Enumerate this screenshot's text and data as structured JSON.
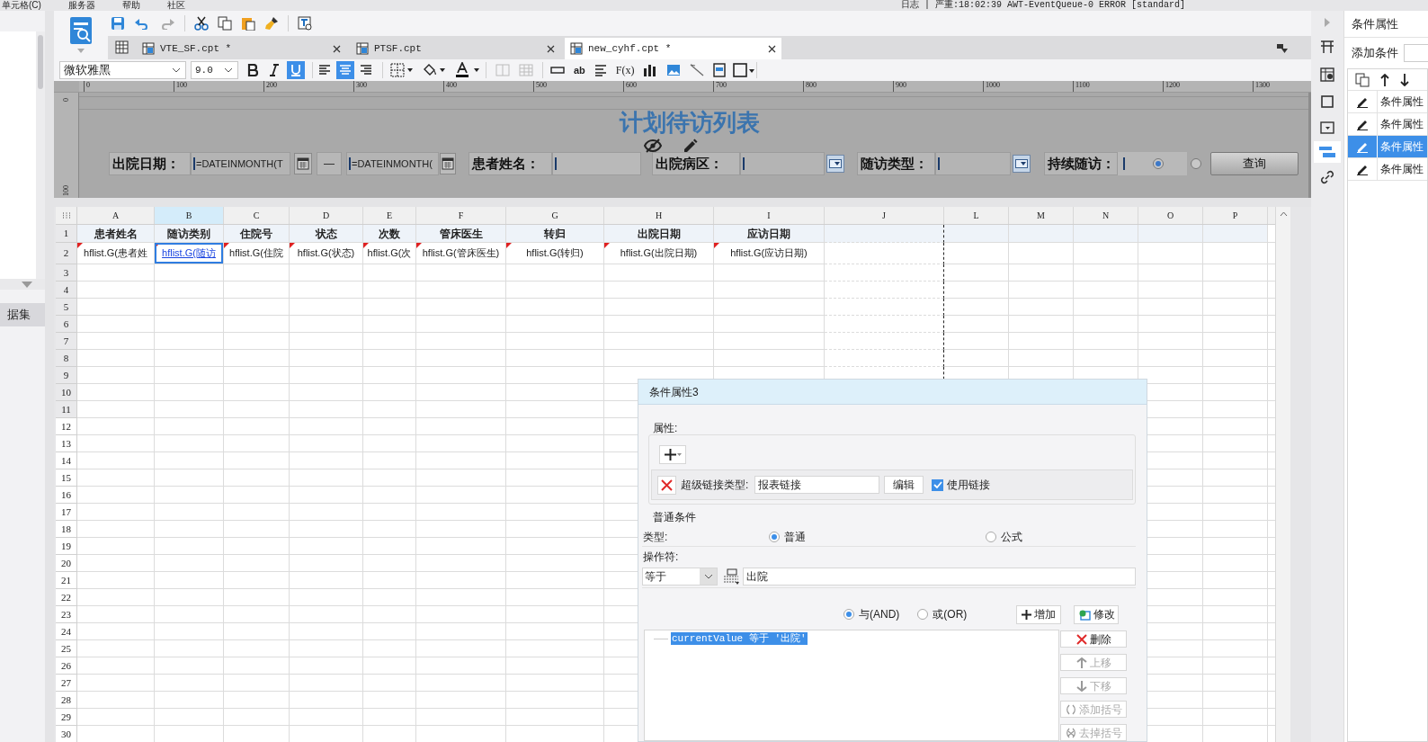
{
  "menu_bar": {
    "items": [
      "单元格(C)",
      "服务器",
      "帮助",
      "社区"
    ],
    "status": "日志 | 严重:18:02:39 AWT-EventQueue-0 ERROR [standard]"
  },
  "file_tabs": [
    {
      "label": "VTE_SF.cpt *",
      "selected": false
    },
    {
      "label": "PTSF.cpt",
      "selected": false
    },
    {
      "label": "new_cyhf.cpt *",
      "selected": true
    }
  ],
  "format_bar": {
    "font": "微软雅黑",
    "size": "9.0",
    "bold": false,
    "italic": false,
    "underline": true,
    "alignment": [
      {
        "selected": false
      },
      {
        "selected": true
      },
      {
        "selected": false
      }
    ],
    "glyph_buttons": [
      "ab",
      "F(x)"
    ]
  },
  "ruler": {
    "ticks": [
      "0",
      "100",
      "200",
      "300",
      "400",
      "500",
      "600",
      "700",
      "800",
      "900",
      "1000",
      "1100",
      "1200",
      "1300"
    ],
    "vertical_ticks": [
      "0",
      "100"
    ]
  },
  "left_panel": {
    "dataset_tab": "据集"
  },
  "report_header": {
    "title": "计划待访列表",
    "params": [
      {
        "kind": "date",
        "label": "出院日期：",
        "from": "=DATEINMONTH(T",
        "separator": "—",
        "to": "=DATEINMONTH("
      },
      {
        "kind": "text",
        "label": "患者姓名："
      },
      {
        "kind": "select",
        "label": "出院病区："
      },
      {
        "kind": "select",
        "label": "随访类型："
      },
      {
        "kind": "radio",
        "label": "持续随访：",
        "options": [
          {
            "selected": true
          },
          {
            "selected": false
          }
        ]
      }
    ],
    "query_button": "查询"
  },
  "sheet": {
    "columns": [
      {
        "label": "A",
        "selected": false
      },
      {
        "label": "B",
        "selected": true
      },
      {
        "label": "C",
        "selected": false
      },
      {
        "label": "D",
        "selected": false
      },
      {
        "label": "E",
        "selected": false
      },
      {
        "label": "F",
        "selected": false
      },
      {
        "label": "G",
        "selected": false
      },
      {
        "label": "H",
        "selected": false
      },
      {
        "label": "I",
        "selected": false
      },
      {
        "label": "J",
        "selected": false
      },
      {
        "label": "L",
        "selected": false
      },
      {
        "label": "M",
        "selected": false
      },
      {
        "label": "N",
        "selected": false
      },
      {
        "label": "O",
        "selected": false
      },
      {
        "label": "P",
        "selected": false
      }
    ],
    "header_row": [
      "患者姓名",
      "随访类别",
      "住院号",
      "状态",
      "次数",
      "管床医生",
      "转归",
      "出院日期",
      "应访日期"
    ],
    "data_row": [
      {
        "text": "hflist.G(患者姓",
        "selected": false
      },
      {
        "text": "hflist.G(随访",
        "selected": true
      },
      {
        "text": "hflist.G(住院",
        "selected": false
      },
      {
        "text": "hflist.G(状态)",
        "selected": false
      },
      {
        "text": "hflist.G(次",
        "selected": false
      },
      {
        "text": "hflist.G(管床医生)",
        "selected": false
      },
      {
        "text": "hflist.G(转归)",
        "selected": false
      },
      {
        "text": "hflist.G(出院日期)",
        "selected": false
      },
      {
        "text": "hflist.G(应访日期)",
        "selected": false
      }
    ],
    "rows": [
      {
        "label": "1",
        "shaded": true
      },
      {
        "label": "2",
        "shaded": true
      },
      {
        "label": "3",
        "shaded": true
      },
      {
        "label": "4",
        "shaded": true
      },
      {
        "label": "5",
        "shaded": true
      },
      {
        "label": "6",
        "shaded": true
      },
      {
        "label": "7",
        "shaded": true
      },
      {
        "label": "8",
        "shaded": true
      },
      {
        "label": "9",
        "shaded": true
      },
      {
        "label": "10",
        "shaded": true
      },
      {
        "label": "11",
        "shaded": true
      },
      {
        "label": "12",
        "shaded": false
      },
      {
        "label": "13",
        "shaded": false
      },
      {
        "label": "14",
        "shaded": false
      },
      {
        "label": "15",
        "shaded": false
      },
      {
        "label": "16",
        "shaded": false
      },
      {
        "label": "17",
        "shaded": false
      },
      {
        "label": "18",
        "shaded": false
      },
      {
        "label": "19",
        "shaded": false
      },
      {
        "label": "20",
        "shaded": false
      },
      {
        "label": "21",
        "shaded": false
      },
      {
        "label": "22",
        "shaded": false
      },
      {
        "label": "23",
        "shaded": false
      },
      {
        "label": "24",
        "shaded": false
      },
      {
        "label": "25",
        "shaded": false
      },
      {
        "label": "26",
        "shaded": false
      },
      {
        "label": "27",
        "shaded": false
      },
      {
        "label": "28",
        "shaded": false
      },
      {
        "label": "29",
        "shaded": false
      },
      {
        "label": "30",
        "shaded": false
      }
    ]
  },
  "dialog": {
    "title": "条件属性3",
    "properties_label": "属性:",
    "hyperlink": {
      "label": "超级链接类型:",
      "value": "报表链接",
      "edit_button": "编辑",
      "use_link": {
        "label": "使用链接",
        "checked": true
      }
    },
    "condition_label": "普通条件",
    "type_label": "类型:",
    "types": [
      {
        "label": "普通",
        "selected": true
      },
      {
        "label": "公式",
        "selected": false
      }
    ],
    "operator_label": "操作符:",
    "operator": "等于",
    "operand": "出院",
    "logic": [
      {
        "label": "与(AND)",
        "selected": true
      },
      {
        "label": "或(OR)",
        "selected": false
      }
    ],
    "add_button": "增加",
    "modify_button": "修改",
    "conditions": [
      {
        "text": "currentValue 等于 '出院'",
        "selected": true
      }
    ],
    "side_buttons": [
      {
        "kind": "delete",
        "label": "删除",
        "disabled": false
      },
      {
        "kind": "up",
        "label": "上移",
        "disabled": true
      },
      {
        "kind": "down",
        "label": "下移",
        "disabled": true
      },
      {
        "kind": "paren",
        "label": "添加括号",
        "disabled": true
      },
      {
        "kind": "unparen",
        "label": "去掉括号",
        "disabled": true
      }
    ]
  },
  "right_panel": {
    "title": "条件属性",
    "add_label": "添加条件",
    "items": [
      {
        "label": "条件属性",
        "selected": false
      },
      {
        "label": "条件属性",
        "selected": false
      },
      {
        "label": "条件属性",
        "selected": true
      },
      {
        "label": "条件属性",
        "selected": false
      }
    ]
  }
}
